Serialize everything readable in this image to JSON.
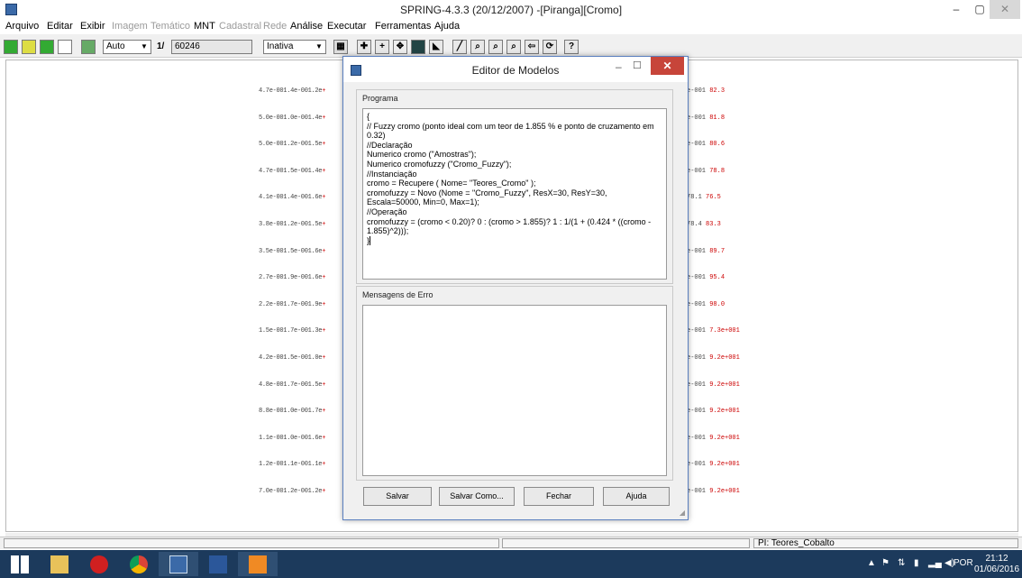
{
  "window": {
    "title": "SPRING-4.3.3 (20/12/2007) -[Piranga][Cromo]",
    "minimize": "–",
    "maximize": "▢",
    "close": "✕"
  },
  "menu": [
    {
      "label": "Arquivo",
      "enabled": true
    },
    {
      "label": "Editar",
      "enabled": true
    },
    {
      "label": "Exibir",
      "enabled": true
    },
    {
      "label": "Imagem",
      "enabled": false
    },
    {
      "label": "Temático",
      "enabled": false
    },
    {
      "label": "MNT",
      "enabled": true
    },
    {
      "label": "Cadastral",
      "enabled": false
    },
    {
      "label": "Rede",
      "enabled": false
    },
    {
      "label": "Análise",
      "enabled": true
    },
    {
      "label": "Executar",
      "enabled": true
    },
    {
      "label": "Ferramentas",
      "enabled": true
    },
    {
      "label": "Ajuda",
      "enabled": true
    }
  ],
  "toolbar": {
    "scale_mode": "Auto",
    "scale_prefix": "1/",
    "scale_value": "60246",
    "mode": "Inativa",
    "help": "?"
  },
  "canvas": {
    "left_points": [
      "4.7e-001.4e-001.2e",
      "5.0e-001.0e-001.4e",
      "5.0e-001.2e-001.5e",
      "4.7e-001.5e-001.4e",
      "4.1e-001.4e-001.6e",
      "3.8e-001.2e-001.5e",
      "3.5e-001.5e-001.6e",
      "2.7e-001.9e-001.6e",
      "2.2e-001.7e-001.9e",
      "1.5e-001.7e-001.3e",
      "4.2e-001.5e-001.0e",
      "4.8e-001.7e-001.5e",
      "8.8e-001.0e-001.7e",
      "1.1e-001.0e-001.6e",
      "1.2e-001.1e-001.1e",
      "7.0e-001.2e-001.2e"
    ],
    "right_points": [
      {
        "a": "e-001",
        "b": "82.3"
      },
      {
        "a": "e-001",
        "b": "81.8"
      },
      {
        "a": "e-001",
        "b": "80.6"
      },
      {
        "a": "e-001",
        "b": "78.8"
      },
      {
        "a": "78.1",
        "b": "76.5"
      },
      {
        "a": "78.4",
        "b": "83.3"
      },
      {
        "a": "e-001",
        "b": "89.7"
      },
      {
        "a": "e-001",
        "b": "95.4"
      },
      {
        "a": "e-001",
        "b": "98.0"
      },
      {
        "a": "e-001",
        "b": "7.3e+001"
      },
      {
        "a": "e-001",
        "b": "9.2e+001"
      },
      {
        "a": "e-001",
        "b": "9.2e+001"
      },
      {
        "a": "e-001",
        "b": "9.2e+001"
      },
      {
        "a": "e-001",
        "b": "9.2e+001"
      },
      {
        "a": "e-001",
        "b": "9.2e+001"
      },
      {
        "a": "e-001",
        "b": "9.2e+001"
      }
    ]
  },
  "status": {
    "plan": "PI: Teores_Cobalto"
  },
  "taskbar": {
    "lang": "POR",
    "time": "21:12",
    "date": "01/06/2016"
  },
  "dialog": {
    "title": "Editor de Modelos",
    "minimize": "–",
    "maximize": "☐",
    "close": "✕",
    "program_label": "Programa",
    "program_text": "{\n// Fuzzy cromo (ponto ideal com um teor de 1.855 % e ponto de cruzamento em 0.32)\n//Declaração\nNumerico cromo (\"Amostras\");\nNumerico cromofuzzy (\"Cromo_Fuzzy\");\n//Instanciação\ncromo = Recupere ( Nome= \"Teores_Cromo\" );\ncromofuzzy = Novo (Nome = \"Cromo_Fuzzy\", ResX=30, ResY=30, Escala=50000, Min=0, Max=1);\n//Operação\ncromofuzzy = (cromo < 0.20)? 0 : (cromo > 1.855)? 1 : 1/(1 + (0.424 * ((cromo - 1.855)^2)));\n}",
    "errors_label": "Mensagens de Erro",
    "errors_text": "",
    "buttons": {
      "save": "Salvar",
      "save_as": "Salvar Como...",
      "close": "Fechar",
      "help": "Ajuda"
    }
  }
}
